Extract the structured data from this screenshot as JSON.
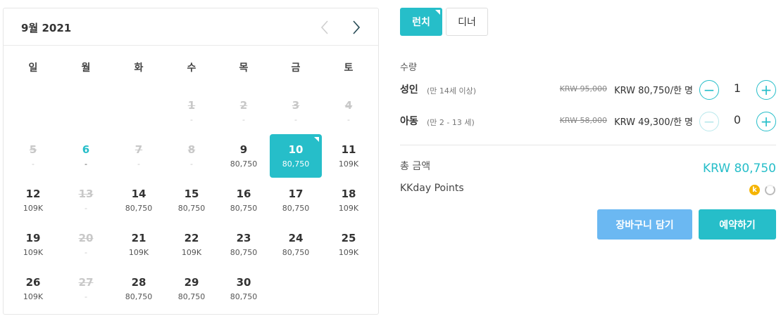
{
  "calendar": {
    "title": "9월 2021",
    "prev_icon": "chevron-left-icon",
    "next_icon": "chevron-right-icon",
    "weekdays": [
      "일",
      "월",
      "화",
      "수",
      "목",
      "금",
      "토"
    ],
    "days": [
      {
        "day": "1",
        "price": "-",
        "state": "disabled"
      },
      {
        "day": "2",
        "price": "-",
        "state": "disabled"
      },
      {
        "day": "3",
        "price": "-",
        "state": "disabled"
      },
      {
        "day": "4",
        "price": "-",
        "state": "disabled"
      },
      {
        "day": "5",
        "price": "-",
        "state": "disabled"
      },
      {
        "day": "6",
        "price": "-",
        "state": "today"
      },
      {
        "day": "7",
        "price": "-",
        "state": "disabled"
      },
      {
        "day": "8",
        "price": "-",
        "state": "disabled"
      },
      {
        "day": "9",
        "price": "80,750",
        "state": "available"
      },
      {
        "day": "10",
        "price": "80,750",
        "state": "selected"
      },
      {
        "day": "11",
        "price": "109K",
        "state": "available"
      },
      {
        "day": "12",
        "price": "109K",
        "state": "available"
      },
      {
        "day": "13",
        "price": "-",
        "state": "disabled"
      },
      {
        "day": "14",
        "price": "80,750",
        "state": "available"
      },
      {
        "day": "15",
        "price": "80,750",
        "state": "available"
      },
      {
        "day": "16",
        "price": "80,750",
        "state": "available"
      },
      {
        "day": "17",
        "price": "80,750",
        "state": "available"
      },
      {
        "day": "18",
        "price": "109K",
        "state": "available"
      },
      {
        "day": "19",
        "price": "109K",
        "state": "available"
      },
      {
        "day": "20",
        "price": "-",
        "state": "disabled"
      },
      {
        "day": "21",
        "price": "109K",
        "state": "available"
      },
      {
        "day": "22",
        "price": "109K",
        "state": "available"
      },
      {
        "day": "23",
        "price": "80,750",
        "state": "available"
      },
      {
        "day": "24",
        "price": "80,750",
        "state": "available"
      },
      {
        "day": "25",
        "price": "109K",
        "state": "available"
      },
      {
        "day": "26",
        "price": "109K",
        "state": "available"
      },
      {
        "day": "27",
        "price": "-",
        "state": "disabled"
      },
      {
        "day": "28",
        "price": "80,750",
        "state": "available"
      },
      {
        "day": "29",
        "price": "80,750",
        "state": "available"
      },
      {
        "day": "30",
        "price": "80,750",
        "state": "available"
      }
    ],
    "first_weekday_index": 3
  },
  "tabs": {
    "lunch": "런치",
    "dinner": "디너"
  },
  "quantity": {
    "label": "수량",
    "adult": {
      "name": "성인",
      "sub": "(만 14세 이상)",
      "original_price": "KRW 95,000",
      "price": "KRW 80,750/한 명",
      "count": "1"
    },
    "child": {
      "name": "아동",
      "sub": "(만 2 - 13 세)",
      "original_price": "KRW 58,000",
      "price": "KRW 49,300/한 명",
      "count": "0"
    }
  },
  "summary": {
    "total_label": "총 금액",
    "total_value": "KRW 80,750",
    "points_label": "KKday Points",
    "points_coin": "k"
  },
  "actions": {
    "cart": "장바구니 담기",
    "book": "예약하기"
  },
  "colors": {
    "accent": "#26bec9",
    "cart_button": "#6bb8f2",
    "coin": "#f5b400"
  }
}
